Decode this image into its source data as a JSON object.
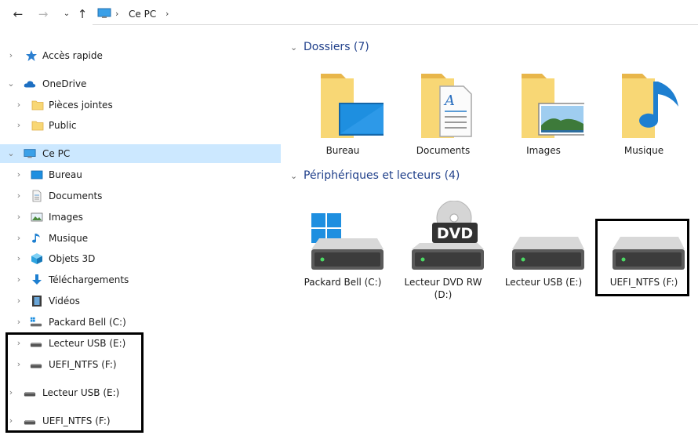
{
  "address": {
    "crumb": "Ce PC"
  },
  "nav": {
    "quick_access": "Accès rapide",
    "onedrive": "OneDrive",
    "onedrive_items": [
      "Pièces jointes",
      "Public"
    ],
    "this_pc": "Ce PC",
    "this_pc_items": [
      "Bureau",
      "Documents",
      "Images",
      "Musique",
      "Objets 3D",
      "Téléchargements",
      "Vidéos",
      "Packard Bell (C:)",
      "Lecteur USB (E:)",
      "UEFI_NTFS (F:)"
    ],
    "top_drives": [
      "Lecteur USB (E:)",
      "UEFI_NTFS (F:)"
    ]
  },
  "folders": {
    "title": "Dossiers (7)",
    "items": [
      "Bureau",
      "Documents",
      "Images",
      "Musique"
    ]
  },
  "devices": {
    "title": "Périphériques et lecteurs (4)",
    "items": [
      "Packard Bell (C:)",
      "Lecteur DVD RW (D:)",
      "Lecteur USB (E:)",
      "UEFI_NTFS (F:)"
    ],
    "dvd_badge": "DVD"
  },
  "colors": {
    "selection": "#cce8ff",
    "folder": "#f8d775",
    "folder_dark": "#e8b64a",
    "accent_blue": "#1e8fe0",
    "title_blue": "#1f3f8a",
    "highlight": "#000000"
  }
}
